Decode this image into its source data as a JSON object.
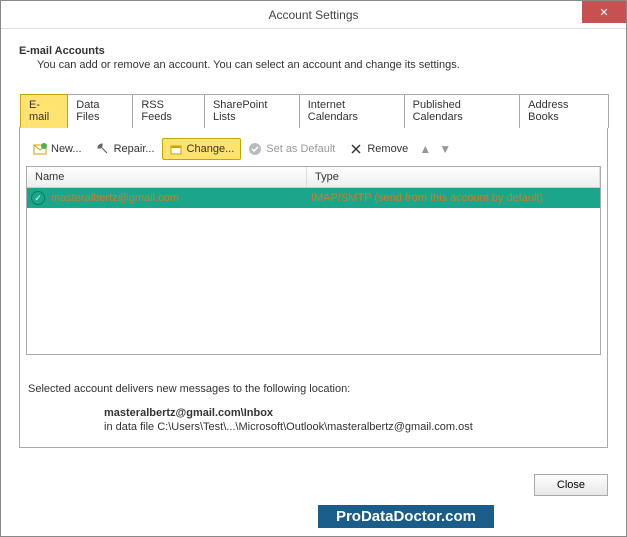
{
  "window": {
    "title": "Account Settings"
  },
  "header": {
    "heading": "E-mail Accounts",
    "subheading": "You can add or remove an account. You can select an account and change its settings."
  },
  "tabs": {
    "items": [
      {
        "label": "E-mail",
        "active": true
      },
      {
        "label": "Data Files"
      },
      {
        "label": "RSS Feeds"
      },
      {
        "label": "SharePoint Lists"
      },
      {
        "label": "Internet Calendars"
      },
      {
        "label": "Published Calendars"
      },
      {
        "label": "Address Books"
      }
    ]
  },
  "toolbar": {
    "new_label": "New...",
    "repair_label": "Repair...",
    "change_label": "Change...",
    "set_default_label": "Set as Default",
    "remove_label": "Remove"
  },
  "table": {
    "columns": {
      "name": "Name",
      "type": "Type"
    },
    "rows": [
      {
        "name": "masteralbertz@gmail.com",
        "type": "IMAP/SMTP (send from this account by default)",
        "selected": true
      }
    ]
  },
  "location": {
    "intro": "Selected account delivers new messages to the following location:",
    "bold": "masteralbertz@gmail.com\\Inbox",
    "sub": "in data file C:\\Users\\Test\\...\\Microsoft\\Outlook\\masteralbertz@gmail.com.ost"
  },
  "footer": {
    "close_label": "Close"
  },
  "watermark": "ProDataDoctor.com"
}
